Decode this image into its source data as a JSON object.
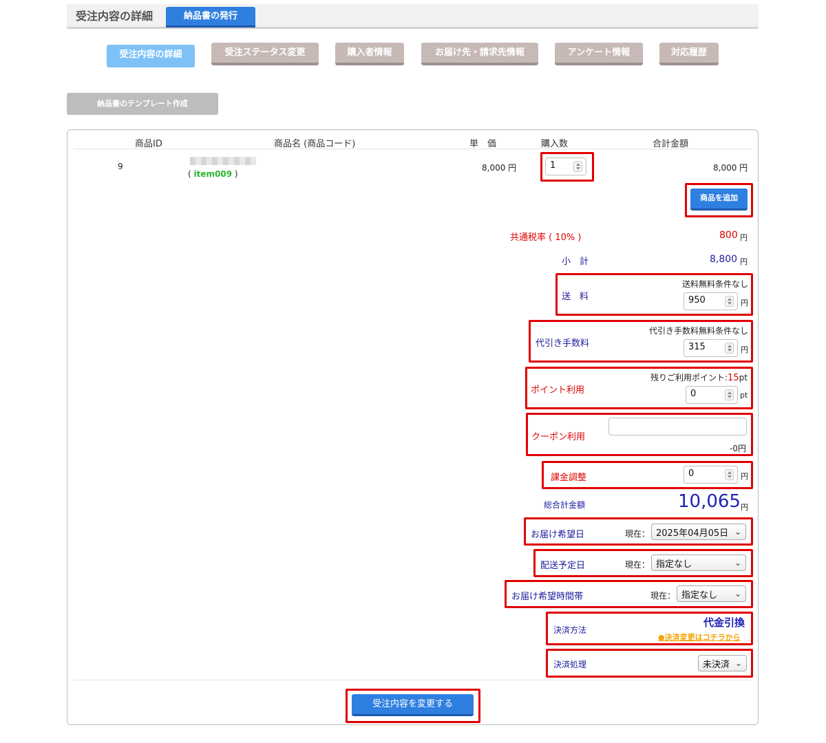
{
  "header": {
    "title": "受注内容の詳細",
    "tab": "納品書の発行"
  },
  "nav_tabs": [
    {
      "label": "受注内容の詳細",
      "active": true
    },
    {
      "label": "受注ステータス変更",
      "active": false
    },
    {
      "label": "購入者情報",
      "active": false
    },
    {
      "label": "お届け先・請求先情報",
      "active": false
    },
    {
      "label": "アンケート情報",
      "active": false
    },
    {
      "label": "対応履歴",
      "active": false
    }
  ],
  "template_button": "納品書のテンプレート作成",
  "table": {
    "headers": {
      "id": "商品ID",
      "name": "商品名 (商品コード)",
      "price": "単　価",
      "qty": "購入数",
      "total": "合計金額"
    },
    "rows": [
      {
        "id": "9",
        "code_open": "( ",
        "code": "item009",
        "code_close": " )",
        "price": "8,000 円",
        "qty": "1",
        "total": "8,000 円"
      }
    ]
  },
  "add_item_button": "商品を追加",
  "summary": {
    "tax_label": "共通税率 ( 10% )",
    "tax_value": "800",
    "yen": "円",
    "subtotal_label": "小　計",
    "subtotal_value": "8,800",
    "shipping_label": "送　料",
    "shipping_note": "送料無料条件なし",
    "shipping_value": "950",
    "cod_label": "代引き手数料",
    "cod_note": "代引き手数料無料条件なし",
    "cod_value": "315",
    "point_label": "ポイント利用",
    "point_note": "残りご利用ポイント:",
    "point_remaining": "15",
    "pt": "pt",
    "point_value": "0",
    "coupon_label": "クーポン利用",
    "coupon_value": "",
    "coupon_amount": "-0円",
    "adjust_label": "課金調整",
    "adjust_value": "0",
    "grand_label": "総合計金額",
    "grand_value": "10,065",
    "delivery_date_label": "お届け希望日",
    "current_label": "現在：",
    "delivery_date_value": "2025年04月05日",
    "ship_date_label": "配送予定日",
    "ship_date_value": "指定なし",
    "delivery_time_label": "お届け希望時間帯",
    "delivery_time_value": "指定なし",
    "payment_method_label": "決済方法",
    "payment_method_value": "代金引換",
    "payment_change_link": "●決済変更はコチラから",
    "payment_process_label": "決済処理",
    "payment_process_value": "未決済"
  },
  "submit_button": "受注内容を変更する",
  "colors": {
    "primary": "#2f7fe0",
    "highlight": "#e00000",
    "tab_inactive": "#c7b9b5",
    "tab_active": "#7dc1f7",
    "navy": "#1c1c9c"
  }
}
